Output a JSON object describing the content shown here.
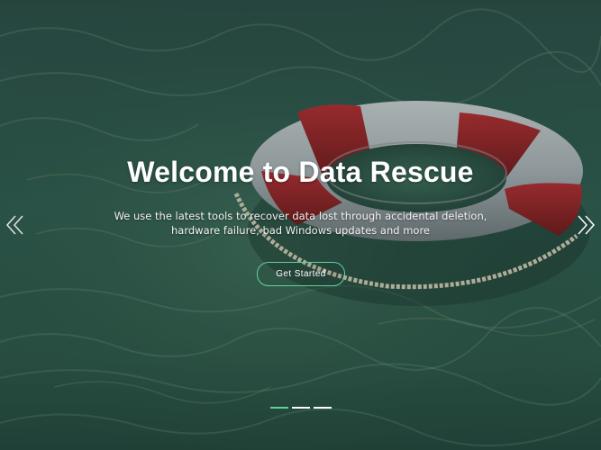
{
  "hero": {
    "title": "Welcome to Data Rescue",
    "subtitle": "We use the latest tools to recover data lost through accidental deletion, hardware failure, bad Windows updates and more",
    "cta_label": "Get Started"
  },
  "carousel": {
    "prev_icon": "chevron-double-left-icon",
    "next_icon": "chevron-double-right-icon",
    "slide_count": 3,
    "active_slide": 1
  },
  "colors": {
    "accent": "#5fd39a",
    "water": "#2f5a4e",
    "lifebuoy_red": "#a8262c",
    "lifebuoy_white": "#b9bdc1"
  }
}
